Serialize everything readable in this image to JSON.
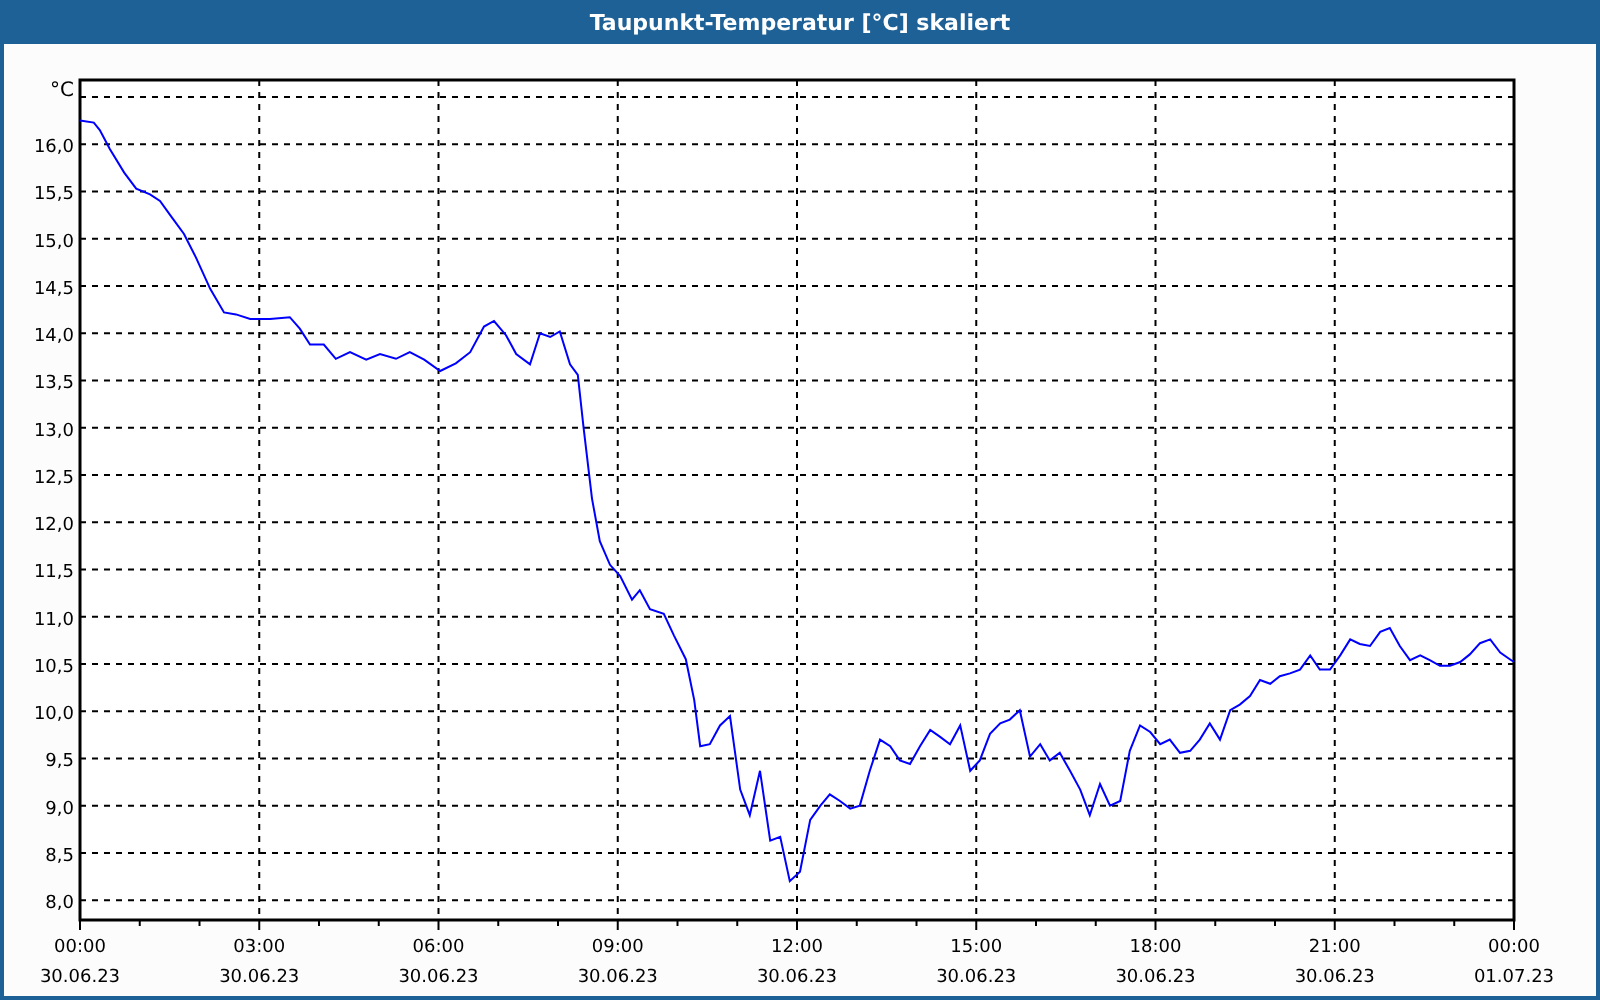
{
  "window": {
    "title": "Taupunkt-Temperatur [°C] skaliert"
  },
  "chart": {
    "chart_data": {
      "type": "line",
      "grid": true,
      "ylabel": "°C",
      "xlim": [
        0,
        24
      ],
      "ylim": [
        7.79,
        16.68
      ],
      "yticks": [
        {
          "value": 8,
          "label": "8,0"
        },
        {
          "value": 8.5,
          "label": "8,5"
        },
        {
          "value": 9,
          "label": "9,0"
        },
        {
          "value": 9.5,
          "label": "9,5"
        },
        {
          "value": 10,
          "label": "10,0"
        },
        {
          "value": 10.5,
          "label": "10,5"
        },
        {
          "value": 11,
          "label": "11,0"
        },
        {
          "value": 11.5,
          "label": "11,5"
        },
        {
          "value": 12,
          "label": "12,0"
        },
        {
          "value": 12.5,
          "label": "12,5"
        },
        {
          "value": 13,
          "label": "13,0"
        },
        {
          "value": 13.5,
          "label": "13,5"
        },
        {
          "value": 14,
          "label": "14,0"
        },
        {
          "value": 14.5,
          "label": "14,5"
        },
        {
          "value": 15,
          "label": "15,0"
        },
        {
          "value": 15.5,
          "label": "15,5"
        },
        {
          "value": 16,
          "label": "16,0"
        }
      ],
      "xticks": [
        {
          "value": 0,
          "label": "00:00"
        },
        {
          "value": 3,
          "label": "03:00"
        },
        {
          "value": 6,
          "label": "06:00"
        },
        {
          "value": 9,
          "label": "09:00"
        },
        {
          "value": 12,
          "label": "12:00"
        },
        {
          "value": 15,
          "label": "15:00"
        },
        {
          "value": 18,
          "label": "18:00"
        },
        {
          "value": 21,
          "label": "21:00"
        },
        {
          "value": 24,
          "label": "00:00"
        }
      ],
      "annotations": [
        "30.06.23",
        "30.06.23",
        "30.06.23",
        "30.06.23",
        "30.06.23",
        "30.06.23",
        "30.06.23",
        "30.06.23",
        "01.07.23"
      ],
      "x": [
        0,
        0.23,
        0.33,
        0.5,
        0.74,
        0.94,
        1.17,
        1.34,
        1.51,
        1.74,
        1.94,
        2.18,
        2.41,
        2.61,
        2.85,
        3.18,
        3.51,
        3.68,
        3.85,
        4.08,
        4.28,
        4.52,
        4.79,
        5.02,
        5.29,
        5.52,
        5.76,
        6.03,
        6.29,
        6.53,
        6.76,
        6.93,
        7.13,
        7.3,
        7.53,
        7.7,
        7.87,
        8.03,
        8.2,
        8.33,
        8.43,
        8.57,
        8.7,
        8.87,
        9.04,
        9.24,
        9.37,
        9.54,
        9.77,
        9.94,
        10.14,
        10.28,
        10.38,
        10.54,
        10.71,
        10.88,
        11.05,
        11.21,
        11.38,
        11.55,
        11.72,
        11.88,
        12.05,
        12.22,
        12.39,
        12.55,
        12.72,
        12.89,
        13.05,
        13.22,
        13.39,
        13.56,
        13.72,
        13.89,
        14.06,
        14.23,
        14.39,
        14.56,
        14.73,
        14.9,
        15.06,
        15.23,
        15.4,
        15.56,
        15.73,
        15.9,
        16.07,
        16.23,
        16.4,
        16.57,
        16.74,
        16.9,
        17.07,
        17.24,
        17.41,
        17.57,
        17.74,
        17.91,
        18.08,
        18.24,
        18.41,
        18.58,
        18.74,
        18.91,
        19.08,
        19.25,
        19.41,
        19.58,
        19.75,
        19.92,
        20.08,
        20.25,
        20.42,
        20.59,
        20.75,
        20.92,
        21.09,
        21.26,
        21.42,
        21.59,
        21.76,
        21.92,
        22.09,
        22.26,
        22.43,
        22.59,
        22.76,
        22.93,
        23.1,
        23.26,
        23.43,
        23.6,
        23.77,
        23.93,
        24
      ],
      "series": [
        {
          "color": "#0000ff",
          "values": [
            16.25,
            16.23,
            16.15,
            15.95,
            15.7,
            15.53,
            15.47,
            15.4,
            15.25,
            15.05,
            14.8,
            14.47,
            14.22,
            14.2,
            14.15,
            14.15,
            14.17,
            14.05,
            13.88,
            13.88,
            13.73,
            13.8,
            13.72,
            13.78,
            13.73,
            13.8,
            13.72,
            13.6,
            13.68,
            13.8,
            14.07,
            14.13,
            13.98,
            13.78,
            13.67,
            14.0,
            13.96,
            14.02,
            13.67,
            13.56,
            13.0,
            12.25,
            11.8,
            11.55,
            11.43,
            11.18,
            11.28,
            11.08,
            11.03,
            10.8,
            10.55,
            10.12,
            9.63,
            9.65,
            9.85,
            9.95,
            9.17,
            8.9,
            9.37,
            8.63,
            8.67,
            8.2,
            8.3,
            8.85,
            9.0,
            9.12,
            9.05,
            8.97,
            9.0,
            9.37,
            9.7,
            9.63,
            9.48,
            9.44,
            9.63,
            9.8,
            9.73,
            9.65,
            9.85,
            9.37,
            9.48,
            9.76,
            9.87,
            9.91,
            10.01,
            9.52,
            9.65,
            9.48,
            9.56,
            9.37,
            9.17,
            8.9,
            9.23,
            9.0,
            9.05,
            9.58,
            9.85,
            9.78,
            9.65,
            9.7,
            9.56,
            9.58,
            9.7,
            9.87,
            9.7,
            10.01,
            10.07,
            10.16,
            10.33,
            10.29,
            10.37,
            10.4,
            10.44,
            10.59,
            10.44,
            10.44,
            10.59,
            10.76,
            10.71,
            10.69,
            10.84,
            10.88,
            10.69,
            10.54,
            10.59,
            10.54,
            10.48,
            10.48,
            10.52,
            10.6,
            10.72,
            10.76,
            10.62,
            10.55,
            10.52
          ]
        }
      ]
    }
  }
}
